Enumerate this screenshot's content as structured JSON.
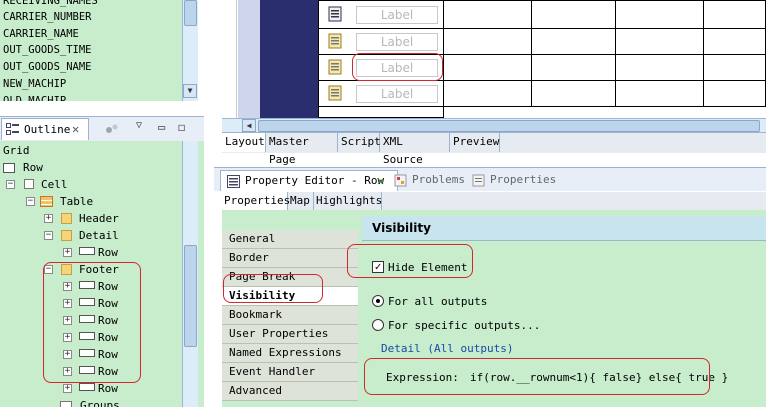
{
  "fields": [
    "RECEIVING_NAMES",
    "CARRIER_NUMBER",
    "CARRIER_NAME",
    "OUT_GOODS_TIME",
    "OUT_GOODS_NAME",
    "NEW_MACHIP",
    "OLD_MACHIP"
  ],
  "outline": {
    "tab_label": "Outline",
    "tree": [
      {
        "label": "Grid"
      },
      {
        "label": "Row"
      },
      {
        "label": "Cell"
      },
      {
        "label": "Table"
      },
      {
        "label": "Header"
      },
      {
        "label": "Detail"
      },
      {
        "label": "Row"
      },
      {
        "label": "Footer"
      },
      {
        "label": "Row"
      },
      {
        "label": "Row"
      },
      {
        "label": "Row"
      },
      {
        "label": "Row"
      },
      {
        "label": "Row"
      },
      {
        "label": "Row"
      },
      {
        "label": "Row"
      },
      {
        "label": "Groups"
      }
    ]
  },
  "editor": {
    "label_text": "Label",
    "tabs": [
      "Layout",
      "Master Page",
      "Script",
      "XML Source",
      "Preview"
    ]
  },
  "property_editor": {
    "title": "Property Editor - Row",
    "other_tabs": [
      "Problems",
      "Properties"
    ],
    "subtabs": [
      "Properties",
      "Map",
      "Highlights"
    ],
    "categories": [
      "General",
      "Border",
      "Page Break",
      "Visibility",
      "Bookmark",
      "User Properties",
      "Named Expressions",
      "Event Handler",
      "Advanced"
    ],
    "selected_category": "Visibility",
    "panel_title": "Visibility",
    "hide_element_label": "Hide Element",
    "hide_element_checked": true,
    "radio_all": "For all outputs",
    "radio_specific": "For specific outputs...",
    "detail_label": "Detail (All outputs)",
    "expression_label": "Expression:",
    "expression_value": "if(row.__rownum<1){ false} else{ true }"
  },
  "colors": {
    "background_green": "#c7edcc",
    "annotation_red": "#d4262e",
    "navy": "#2a2e6e"
  }
}
